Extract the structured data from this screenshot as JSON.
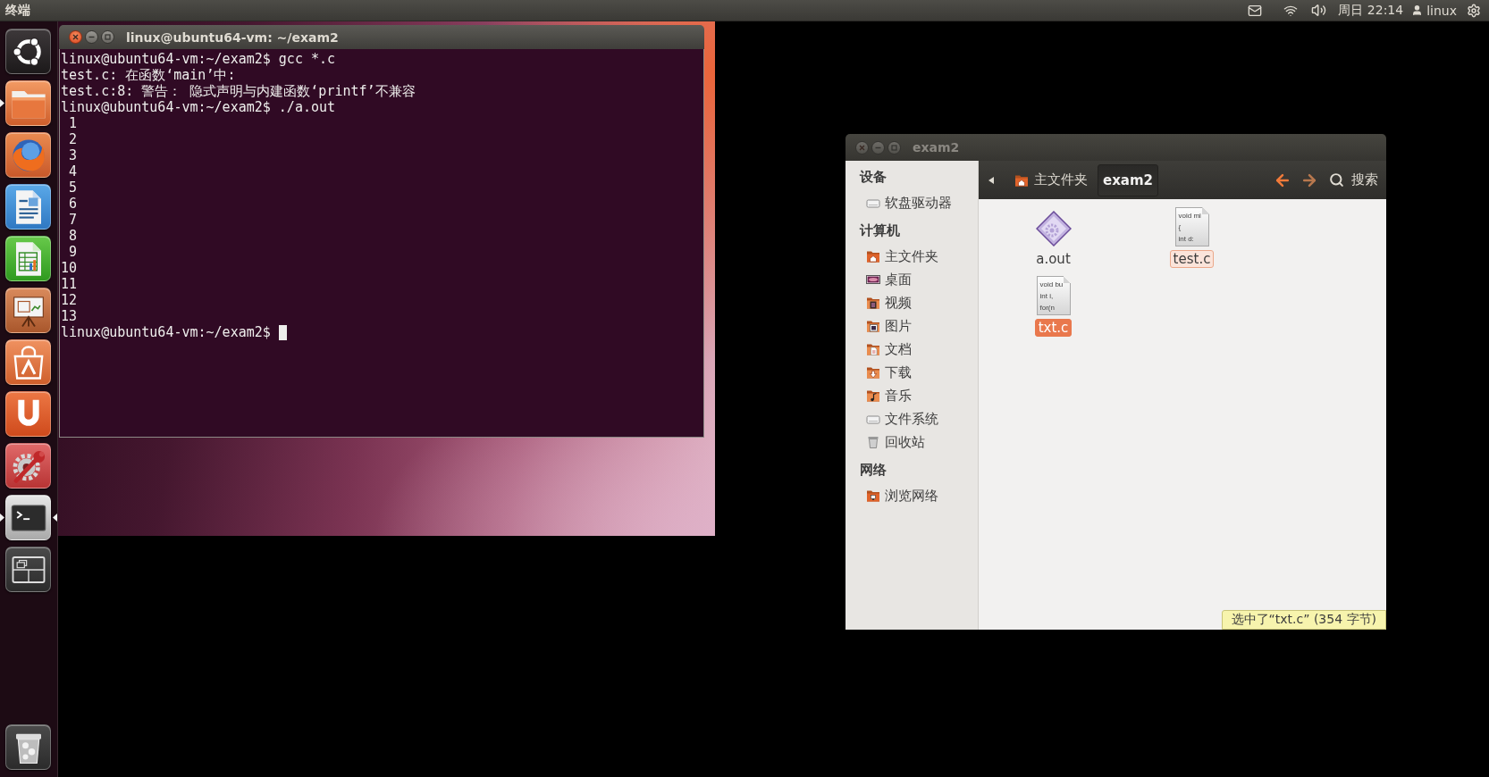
{
  "top_panel": {
    "app_title": "终端",
    "clock": "周日 22:14",
    "user": "linux"
  },
  "launcher": {
    "items": [
      {
        "kind": "dash",
        "running": false,
        "focused": false
      },
      {
        "kind": "files",
        "running": true,
        "focused": false
      },
      {
        "kind": "browser",
        "running": false,
        "focused": false
      },
      {
        "kind": "document",
        "running": false,
        "focused": false
      },
      {
        "kind": "spreadsheet",
        "running": false,
        "focused": false
      },
      {
        "kind": "presentation",
        "running": false,
        "focused": false
      },
      {
        "kind": "software",
        "running": false,
        "focused": false
      },
      {
        "kind": "cloud",
        "running": false,
        "focused": false
      },
      {
        "kind": "settings",
        "running": false,
        "focused": false
      },
      {
        "kind": "terminal",
        "running": true,
        "focused": true
      },
      {
        "kind": "workspaces",
        "running": false,
        "focused": false
      },
      {
        "kind": "trash",
        "running": false,
        "focused": false
      }
    ]
  },
  "terminal_window": {
    "title": "linux@ubuntu64-vm: ~/exam2",
    "active": true,
    "cursor": true,
    "lines": [
      "linux@ubuntu64-vm:~/exam2$ gcc *.c",
      "test.c: 在函数‘main’中:",
      "test.c:8: 警告： 隐式声明与内建函数‘printf’不兼容",
      "linux@ubuntu64-vm:~/exam2$ ./a.out",
      " 1",
      " 2",
      " 3",
      " 4",
      " 5",
      " 6",
      " 7",
      " 8",
      " 9",
      "10",
      "11",
      "12",
      "13",
      "linux@ubuntu64-vm:~/exam2$"
    ]
  },
  "file_window": {
    "title": "exam2",
    "active": false,
    "sidebar": [
      {
        "heading": "设备",
        "items": [
          {
            "label": "软盘驱动器",
            "kind": "drive",
            "selected": false
          }
        ]
      },
      {
        "heading": "计算机",
        "items": [
          {
            "label": "主文件夹",
            "kind": "home",
            "selected": false
          },
          {
            "label": "桌面",
            "kind": "desktop",
            "selected": false
          },
          {
            "label": "视频",
            "kind": "videos",
            "selected": false
          },
          {
            "label": "图片",
            "kind": "pictures",
            "selected": false
          },
          {
            "label": "文档",
            "kind": "documents",
            "selected": false
          },
          {
            "label": "下载",
            "kind": "downloads",
            "selected": false
          },
          {
            "label": "音乐",
            "kind": "music",
            "selected": false
          },
          {
            "label": "文件系统",
            "kind": "filesystem",
            "selected": false
          },
          {
            "label": "回收站",
            "kind": "trash",
            "selected": false
          }
        ]
      },
      {
        "heading": "网络",
        "items": [
          {
            "label": "浏览网络",
            "kind": "network",
            "selected": false
          }
        ]
      }
    ],
    "path": [
      {
        "label": "主文件夹",
        "kind": "home",
        "selected": false
      },
      {
        "label": "exam2",
        "kind": "folder",
        "selected": true
      }
    ],
    "nav": [
      {
        "kind": "back",
        "disabled": false
      },
      {
        "kind": "forward",
        "disabled": true
      }
    ],
    "search": "搜索",
    "files": [
      {
        "name": "a.out",
        "kind": "executable",
        "selected": false,
        "hovered": false
      },
      {
        "name": "test.c",
        "kind": "source",
        "selected": false,
        "hovered": true,
        "preview": [
          "void mi",
          "{",
          "int d:"
        ]
      },
      {
        "name": "txt.c",
        "kind": "source",
        "selected": true,
        "hovered": false,
        "preview": [
          "void bu",
          "int i,",
          "for(n"
        ]
      }
    ],
    "status": "选中了“txt.c” (354 字节)"
  }
}
